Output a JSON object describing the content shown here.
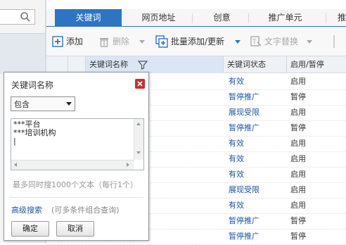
{
  "tabs": [
    "关键词",
    "网页地址",
    "创意",
    "推广单元",
    "推"
  ],
  "toolbar": {
    "add": "添加",
    "delete": "删除",
    "batch": "批量添加/更新",
    "replace": "文字替换"
  },
  "table": {
    "headers": {
      "name": "关键词名称",
      "status": "关键词状态",
      "state": "启用/暂停"
    },
    "rows": [
      {
        "status": "有效",
        "state": "启用"
      },
      {
        "status": "暂停推广",
        "state": "暂停"
      },
      {
        "status": "展现受限",
        "state": "启用"
      },
      {
        "status": "暂停推广",
        "state": "暂停"
      },
      {
        "status": "有效",
        "state": "启用"
      },
      {
        "status": "有效",
        "state": "启用"
      },
      {
        "status": "有效",
        "state": "启用"
      },
      {
        "status": "展现受限",
        "state": "启用"
      },
      {
        "status": "有效",
        "state": "启用"
      },
      {
        "status": "暂停推广",
        "state": "暂停"
      },
      {
        "status": "暂停推广",
        "state": "暂停"
      }
    ]
  },
  "popup": {
    "title": "关键词名称",
    "match_value": "包含",
    "keywords": "***平台\n***培训机构\n|",
    "hint": "最多同时搜1000个文本（每行1个）",
    "advanced_link": "高级搜索",
    "advanced_note": "(可多条件组合查询)",
    "ok": "确定",
    "cancel": "取消"
  },
  "colors": {
    "accent": "#2d75c3",
    "link": "#1f56a8",
    "close": "#c9302c"
  }
}
